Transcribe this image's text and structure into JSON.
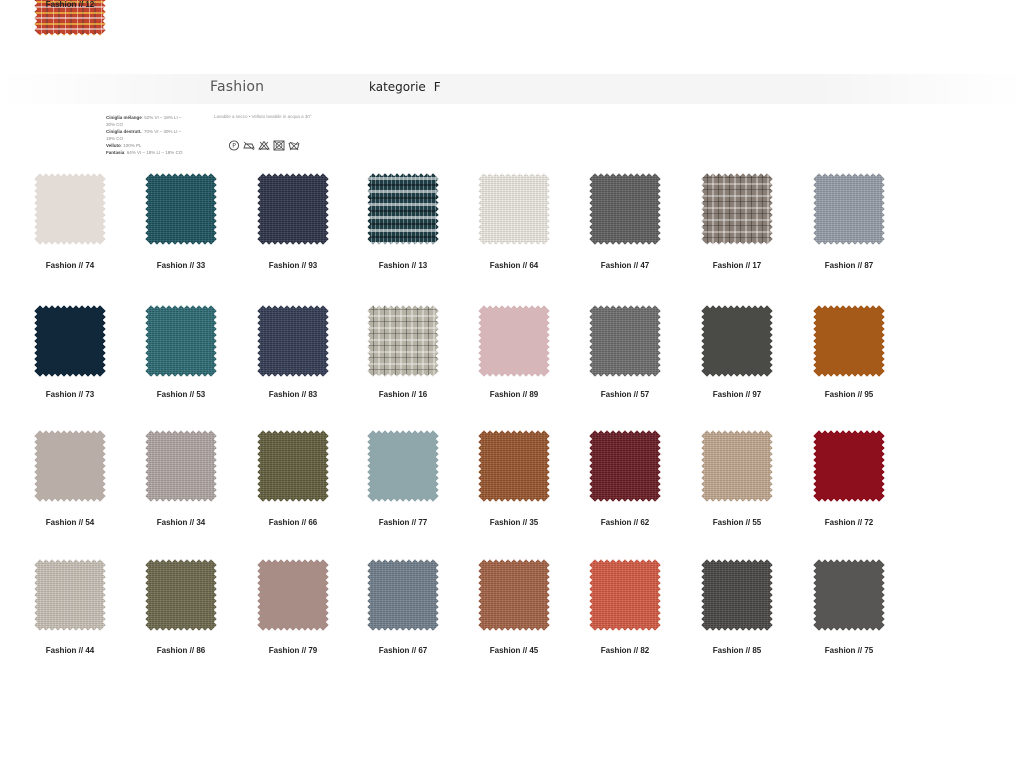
{
  "header": {
    "title": "Fashion",
    "category_label": "kategorie",
    "category_value": "F"
  },
  "specs": [
    {
      "name": "Ciniglia mélange",
      "value": "52% VI – 18% LI – 30% CO"
    },
    {
      "name": "Ciniglia destrutt.",
      "value": "70% VI – 30% LI – 19% CO"
    },
    {
      "name": "Velluto",
      "value": "100% PL"
    },
    {
      "name": "Fantasia",
      "value": "64% VI – 18% LI – 18% CO"
    }
  ],
  "care_text": "Lavabile a secco • Velluto lavabile in acqua a 30°",
  "care_icons": [
    "dry-clean-p-icon",
    "no-iron-icon",
    "no-bleach-icon",
    "no-tumble-dry-icon",
    "no-wash-icon"
  ],
  "swatches": [
    {
      "label": "Fashion // 74",
      "color": "#e3dbd6",
      "texture": "flat"
    },
    {
      "label": "Fashion // 33",
      "color": "#1d5560",
      "texture": "weave"
    },
    {
      "label": "Fashion // 93",
      "color": "#2e3448",
      "texture": "weave"
    },
    {
      "label": "Fashion // 13",
      "color": "#1e3d45",
      "texture": "ikat"
    },
    {
      "label": "Fashion // 64",
      "color": "#efebe4",
      "texture": "weave"
    },
    {
      "label": "Fashion // 47",
      "color": "#606060",
      "texture": "weave"
    },
    {
      "label": "Fashion // 17",
      "color": "#8a7f76",
      "texture": "check"
    },
    {
      "label": "Fashion // 87",
      "color": "#98a0ab",
      "texture": "weave"
    },
    {
      "label": "Fashion // 73",
      "color": "#10283a",
      "texture": "flat"
    },
    {
      "label": "Fashion // 53",
      "color": "#2d6b74",
      "texture": "weave"
    },
    {
      "label": "Fashion // 83",
      "color": "#343d55",
      "texture": "weave"
    },
    {
      "label": "Fashion // 16",
      "color": "#b8b3a7",
      "texture": "check"
    },
    {
      "label": "Fashion // 89",
      "color": "#d6b6b8",
      "texture": "flat"
    },
    {
      "label": "Fashion // 57",
      "color": "#6f6f6f",
      "texture": "weave"
    },
    {
      "label": "Fashion // 97",
      "color": "#4a4a47",
      "texture": "flat"
    },
    {
      "label": "Fashion // 95",
      "color": "#a65a1a",
      "texture": "flat"
    },
    {
      "label": "Fashion // 54",
      "color": "#b9ada7",
      "texture": "flat"
    },
    {
      "label": "Fashion // 34",
      "color": "#b2a9a6",
      "texture": "weave"
    },
    {
      "label": "Fashion // 66",
      "color": "#63603f",
      "texture": "weave"
    },
    {
      "label": "Fashion // 77",
      "color": "#8fa7ab",
      "texture": "flat"
    },
    {
      "label": "Fashion // 35",
      "color": "#9a5830",
      "texture": "weave"
    },
    {
      "label": "Fashion // 62",
      "color": "#6b1d25",
      "texture": "weave"
    },
    {
      "label": "Fashion // 55",
      "color": "#c4ab93",
      "texture": "weave"
    },
    {
      "label": "Fashion // 72",
      "color": "#8d0f1e",
      "texture": "flat"
    },
    {
      "label": "Fashion // 44",
      "color": "#cbc4ba",
      "texture": "weave"
    },
    {
      "label": "Fashion // 86",
      "color": "#6e6a4f",
      "texture": "weave"
    },
    {
      "label": "Fashion // 79",
      "color": "#a78d85",
      "texture": "flat"
    },
    {
      "label": "Fashion // 67",
      "color": "#72808d",
      "texture": "weave"
    },
    {
      "label": "Fashion // 45",
      "color": "#a56447",
      "texture": "weave"
    },
    {
      "label": "Fashion // 82",
      "color": "#d65c44",
      "texture": "weave"
    },
    {
      "label": "Fashion // 85",
      "color": "#4a4846",
      "texture": "weave"
    },
    {
      "label": "Fashion // 75",
      "color": "#575655",
      "texture": "flat"
    },
    {
      "label": "Fashion // 12",
      "color": "#c1422d",
      "texture": "multi"
    }
  ]
}
